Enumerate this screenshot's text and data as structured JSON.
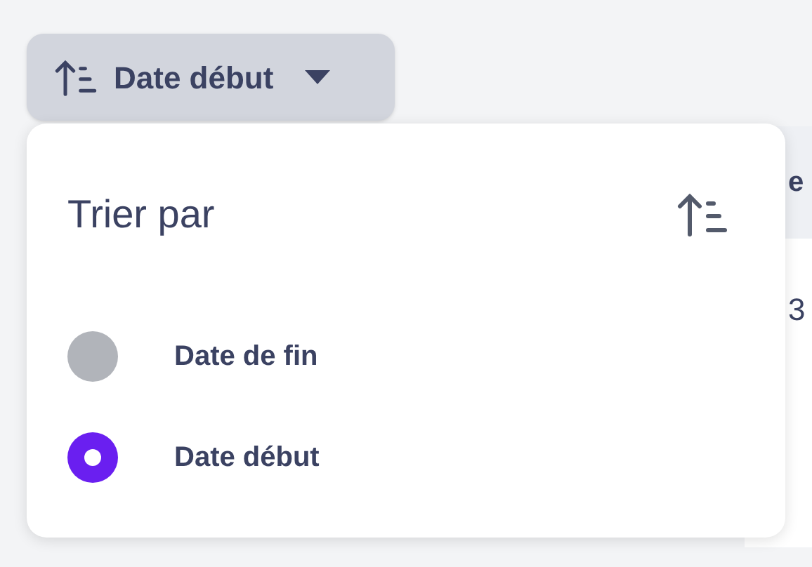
{
  "sort_button": {
    "label": "Date début"
  },
  "table": {
    "header": "e",
    "cell": "3"
  },
  "dropdown": {
    "title": "Trier par",
    "options": [
      {
        "label": "Date de fin",
        "selected": false
      },
      {
        "label": "Date début",
        "selected": true
      }
    ]
  }
}
